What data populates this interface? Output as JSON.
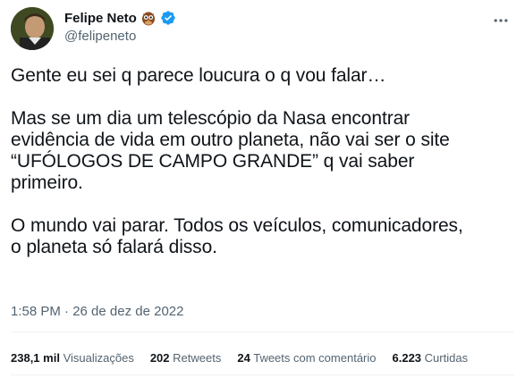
{
  "author": {
    "display_name": "Felipe Neto",
    "handle": "@felipeneto",
    "badge_icons": [
      "owl-icon",
      "verified-icon"
    ],
    "verified_color": "#1d9bf0"
  },
  "tweet": {
    "paragraphs": [
      [
        "Gente eu sei q parece loucura o q vou falar…"
      ],
      [
        "Mas se um dia um telescópio da Nasa encontrar",
        "evidência de vida em outro planeta, não vai ser o site",
        "“UFÓLOGOS DE CAMPO GRANDE” q vai saber",
        "primeiro."
      ],
      [
        "O mundo vai parar. Todos os veículos, comunicadores,",
        "o planeta só falará disso."
      ]
    ],
    "timestamp": "1:58 PM · 26 de dez de 2022"
  },
  "stats": [
    {
      "value": "238,1 mil",
      "label": "Visualizações"
    },
    {
      "value": "202",
      "label": "Retweets"
    },
    {
      "value": "24",
      "label": "Tweets com comentário"
    },
    {
      "value": "6.223",
      "label": "Curtidas"
    }
  ],
  "colors": {
    "text": "#0f1419",
    "secondary": "#536471",
    "divider": "#eff3f4"
  }
}
